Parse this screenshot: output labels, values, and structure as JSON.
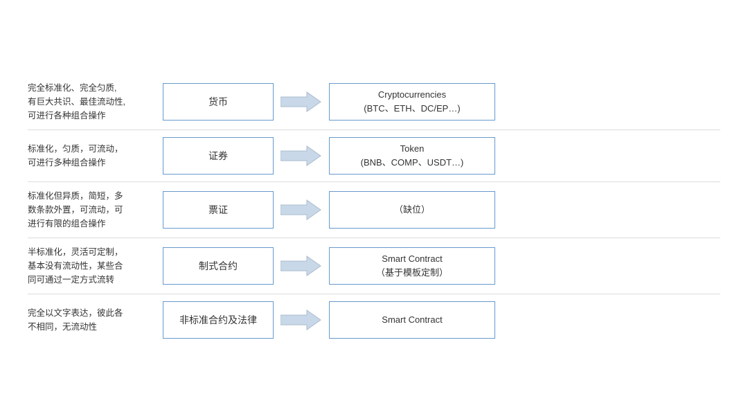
{
  "rows": [
    {
      "id": "row1",
      "desc": "完全标准化、完全匀质,\n有巨大共识、最佳流动性,\n可进行各种组合操作",
      "center": "货币",
      "right_line1": "Cryptocurrencies",
      "right_line2": "(BTC、ETH、DC/EP…)"
    },
    {
      "id": "row2",
      "desc": "标准化，匀质，可流动，\n可进行多种组合操作",
      "center": "证券",
      "right_line1": "Token",
      "right_line2": "(BNB、COMP、USDT…)"
    },
    {
      "id": "row3",
      "desc": "标准化但异质，简短，多\n数条款外置，可流动，可\n进行有限的组合操作",
      "center": "票证",
      "right_line1": "（缺位）",
      "right_line2": ""
    },
    {
      "id": "row4",
      "desc": "半标准化，灵活可定制，\n基本没有流动性，某些合\n同可通过一定方式流转",
      "center": "制式合约",
      "right_line1": "Smart Contract",
      "right_line2": "（基于模板定制）"
    },
    {
      "id": "row5",
      "desc": "完全以文字表达，彼此各\n不相同，无流动性",
      "center": "非标准合约及法律",
      "right_line1": "Smart Contract",
      "right_line2": ""
    }
  ]
}
